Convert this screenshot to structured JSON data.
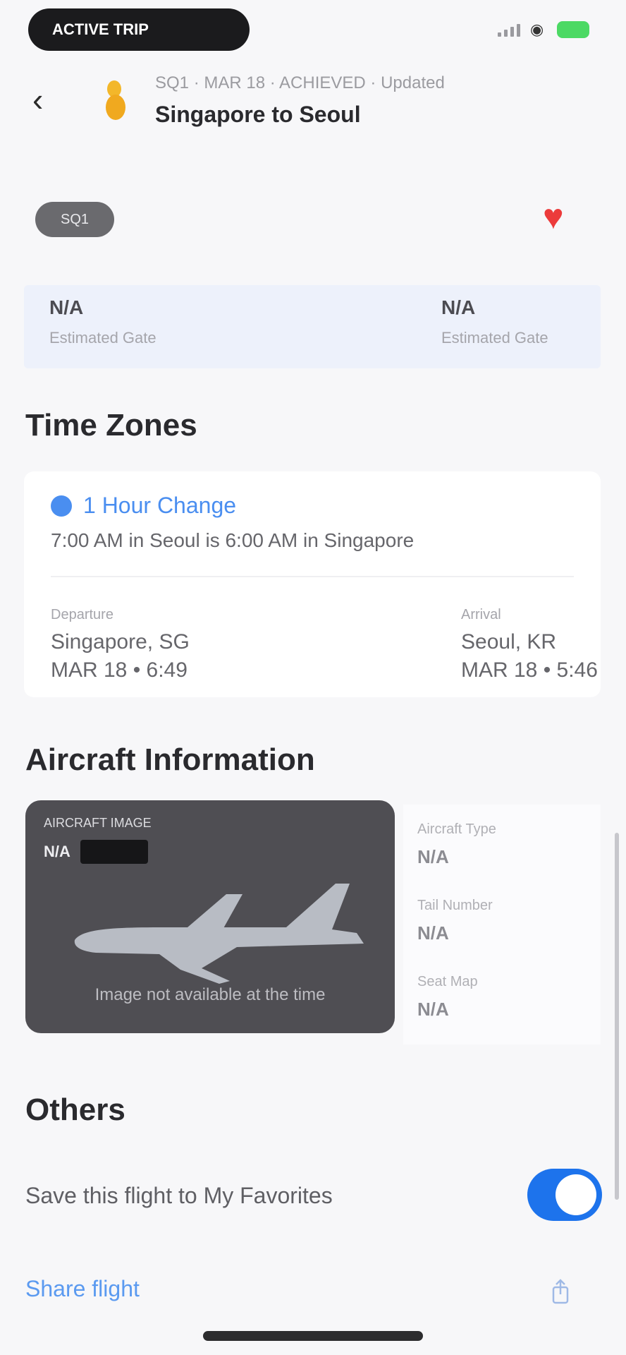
{
  "status_bar": {
    "pill_text": "ACTIVE TRIP"
  },
  "header": {
    "subtitle": "SQ1 · MAR 18 · ACHIEVED · Updated",
    "title": "Singapore to Seoul"
  },
  "badge": {
    "label": "SQ1"
  },
  "terminals": {
    "departure": {
      "value": "N/A",
      "label": "Estimated Gate"
    },
    "arrival": {
      "value": "N/A",
      "label": "Estimated Gate"
    }
  },
  "time_zones": {
    "section_title": "Time Zones",
    "change_label": "1 Hour Change",
    "description": "7:00 AM in Seoul is 6:00 AM in Singapore",
    "departure": {
      "label": "Departure",
      "city": "Singapore, SG",
      "date": "MAR 18 • 6:49"
    },
    "arrival": {
      "label": "Arrival",
      "city": "Seoul, KR",
      "date": "MAR 18 • 5:46"
    }
  },
  "aircraft": {
    "section_title": "Aircraft Information",
    "model_label": "AIRCRAFT IMAGE",
    "model_value": "N/A",
    "caption": "Image not available at the time",
    "details": [
      {
        "label": "Aircraft Type",
        "value": "N/A"
      },
      {
        "label": "Tail Number",
        "value": "N/A"
      },
      {
        "label": "Seat Map",
        "value": "N/A"
      }
    ]
  },
  "others": {
    "section_title": "Others",
    "favorites_label": "Save this flight to My Favorites",
    "favorites_on": true,
    "share_label": "Share flight"
  }
}
